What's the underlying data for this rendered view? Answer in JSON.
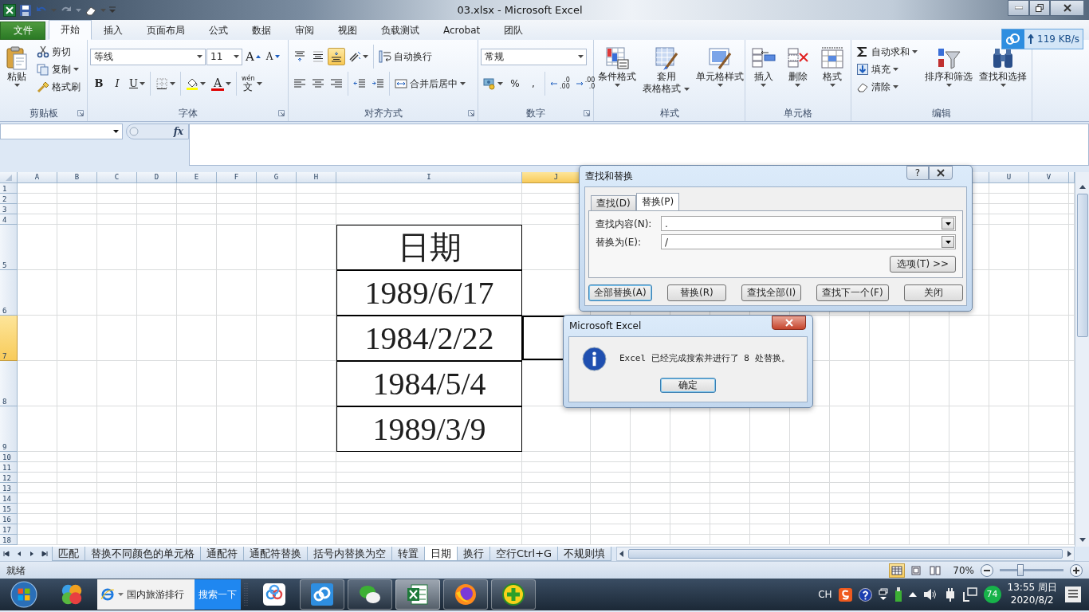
{
  "title_bar": {
    "title": "03.xlsx - Microsoft Excel"
  },
  "ribbon_tabs": [
    {
      "label": "文件",
      "kind": "file",
      "selected": false
    },
    {
      "label": "开始",
      "kind": "tab",
      "selected": true
    },
    {
      "label": "插入",
      "kind": "tab",
      "selected": false
    },
    {
      "label": "页面布局",
      "kind": "tab",
      "selected": false
    },
    {
      "label": "公式",
      "kind": "tab",
      "selected": false
    },
    {
      "label": "数据",
      "kind": "tab",
      "selected": false
    },
    {
      "label": "审阅",
      "kind": "tab",
      "selected": false
    },
    {
      "label": "视图",
      "kind": "tab",
      "selected": false
    },
    {
      "label": "负载测试",
      "kind": "tab",
      "selected": false
    },
    {
      "label": "Acrobat",
      "kind": "tab",
      "selected": false
    },
    {
      "label": "团队",
      "kind": "tab",
      "selected": false
    }
  ],
  "upload_widget": {
    "speed": "119 KB/s"
  },
  "ribbon_groups": [
    {
      "title": "剪贴板",
      "kind": "clipboard",
      "launcher": true,
      "large": [
        {
          "lines": [
            "粘贴"
          ],
          "dropdown": true
        }
      ],
      "small": [
        {
          "label": "剪切",
          "dropdown": false
        },
        {
          "label": "复制",
          "dropdown": true
        },
        {
          "label": "格式刷",
          "dropdown": false
        }
      ]
    },
    {
      "title": "字体",
      "kind": "font",
      "launcher": true,
      "font_name": "等线",
      "font_size": "11",
      "size_buttons": [
        "A",
        "A"
      ],
      "style_buttons": [
        {
          "label": "B",
          "dropdown": false
        },
        {
          "label": "I",
          "dropdown": false
        },
        {
          "label": "U",
          "dropdown": true
        }
      ],
      "font_color_glyph": "A",
      "phonetic": [
        "wén",
        "文"
      ]
    },
    {
      "title": "对齐方式",
      "kind": "alignment",
      "launcher": true,
      "vertical_align": [
        {
          "selected": false
        },
        {
          "selected": false
        },
        {
          "selected": true
        }
      ],
      "horizontal_align": [
        {
          "selected": false
        },
        {
          "selected": false
        },
        {
          "selected": false
        }
      ],
      "small": [
        {
          "label": "自动换行",
          "dropdown": false
        },
        {
          "label": "合并后居中",
          "dropdown": true
        }
      ]
    },
    {
      "title": "数字",
      "kind": "number",
      "launcher": true,
      "number_format": "常规",
      "symbols": [
        "%",
        ","
      ],
      "decimal_buttons": [
        [
          ".0",
          ".00"
        ],
        [
          ".00",
          ".0"
        ]
      ]
    },
    {
      "title": "样式",
      "kind": "styles",
      "launcher": false,
      "large": [
        {
          "lines": [
            "条件格式"
          ],
          "dropdown": true
        },
        {
          "lines": [
            "套用",
            "表格格式"
          ],
          "dropdown": true
        },
        {
          "lines": [
            "单元格样式"
          ],
          "dropdown": true
        }
      ]
    },
    {
      "title": "单元格",
      "kind": "cells",
      "launcher": false,
      "large": [
        {
          "lines": [
            "插入"
          ],
          "dropdown": true
        },
        {
          "lines": [
            "删除"
          ],
          "dropdown": true
        },
        {
          "lines": [
            "格式"
          ],
          "dropdown": true
        }
      ]
    },
    {
      "title": "编辑",
      "kind": "editing",
      "launcher": false,
      "small": [
        {
          "label": "自动求和",
          "dropdown": true
        },
        {
          "label": "填充",
          "dropdown": true
        },
        {
          "label": "清除",
          "dropdown": true
        }
      ],
      "large": [
        {
          "lines": [
            "排序和筛选"
          ],
          "dropdown": true
        },
        {
          "lines": [
            "查找和选择"
          ],
          "dropdown": true
        }
      ]
    }
  ],
  "formula_bar": {
    "function_label": "fx"
  },
  "sheet": {
    "columns": [
      {
        "label": "A",
        "selected": false
      },
      {
        "label": "B",
        "selected": false
      },
      {
        "label": "C",
        "selected": false
      },
      {
        "label": "D",
        "selected": false
      },
      {
        "label": "E",
        "selected": false
      },
      {
        "label": "F",
        "selected": false
      },
      {
        "label": "G",
        "selected": false
      },
      {
        "label": "H",
        "selected": false
      },
      {
        "label": "I",
        "selected": false
      },
      {
        "label": "J",
        "selected": true
      },
      {
        "label": "U",
        "selected": false
      },
      {
        "label": "V",
        "selected": false
      }
    ],
    "rows": [
      {
        "label": "1",
        "selected": false
      },
      {
        "label": "2",
        "selected": false
      },
      {
        "label": "3",
        "selected": false
      },
      {
        "label": "4",
        "selected": false
      },
      {
        "label": "5",
        "selected": false
      },
      {
        "label": "6",
        "selected": false
      },
      {
        "label": "7",
        "selected": true
      },
      {
        "label": "8",
        "selected": false
      },
      {
        "label": "9",
        "selected": false
      },
      {
        "label": "10",
        "selected": false
      },
      {
        "label": "11",
        "selected": false
      },
      {
        "label": "12",
        "selected": false
      },
      {
        "label": "13",
        "selected": false
      },
      {
        "label": "14",
        "selected": false
      },
      {
        "label": "15",
        "selected": false
      },
      {
        "label": "16",
        "selected": false
      },
      {
        "label": "17",
        "selected": false
      },
      {
        "label": "18",
        "selected": false
      }
    ],
    "date_column": [
      "日期",
      "1989/6/17",
      "1984/2/22",
      "1984/5/4",
      "1989/3/9"
    ]
  },
  "sheet_tabs": [
    {
      "label": "匹配",
      "selected": false
    },
    {
      "label": "替换不同颜色的单元格",
      "selected": false
    },
    {
      "label": "通配符",
      "selected": false
    },
    {
      "label": "通配符替换",
      "selected": false
    },
    {
      "label": "括号内替换为空",
      "selected": false
    },
    {
      "label": "转置",
      "selected": false
    },
    {
      "label": "日期",
      "selected": true
    },
    {
      "label": "换行",
      "selected": false
    },
    {
      "label": "空行Ctrl+G",
      "selected": false
    },
    {
      "label": "不规则填",
      "selected": false
    }
  ],
  "status_bar": {
    "status": "就绪",
    "view_buttons": [
      {
        "selected": true
      },
      {
        "selected": false
      },
      {
        "selected": false
      }
    ],
    "zoom": "70%",
    "zoom_slider": {
      "level": 0.33
    }
  },
  "find_replace_dialog": {
    "title": "查找和替换",
    "help": "?",
    "tabs": [
      {
        "label": "查找(D)",
        "selected": false
      },
      {
        "label": "替换(P)",
        "selected": true
      }
    ],
    "fields": [
      {
        "label": "查找内容(N):",
        "value": "."
      },
      {
        "label": "替换为(E):",
        "value": "/"
      }
    ],
    "options_button": "选项(T) >>",
    "buttons": [
      {
        "label": "全部替换(A)",
        "default": true
      },
      {
        "label": "替换(R)",
        "default": false
      },
      {
        "label": "查找全部(I)",
        "default": false
      },
      {
        "label": "查找下一个(F)",
        "default": false
      },
      {
        "label": "关闭",
        "default": false
      }
    ]
  },
  "message_box": {
    "title": "Microsoft Excel",
    "message": "Excel 已经完成搜索并进行了 8 处替换。",
    "button": "确定"
  },
  "taskbar": {
    "search": {
      "value": "国内旅游排行",
      "button": "搜索一下"
    },
    "apps": [
      {
        "running": false,
        "selected": false
      },
      {
        "running": true,
        "selected": false
      },
      {
        "running": true,
        "selected": false
      },
      {
        "running": true,
        "selected": true
      },
      {
        "running": true,
        "selected": false
      },
      {
        "running": true,
        "selected": false
      }
    ],
    "tray": {
      "language": "CH",
      "badge": "74",
      "time": "13:55 周日",
      "date": "2020/8/2"
    }
  }
}
